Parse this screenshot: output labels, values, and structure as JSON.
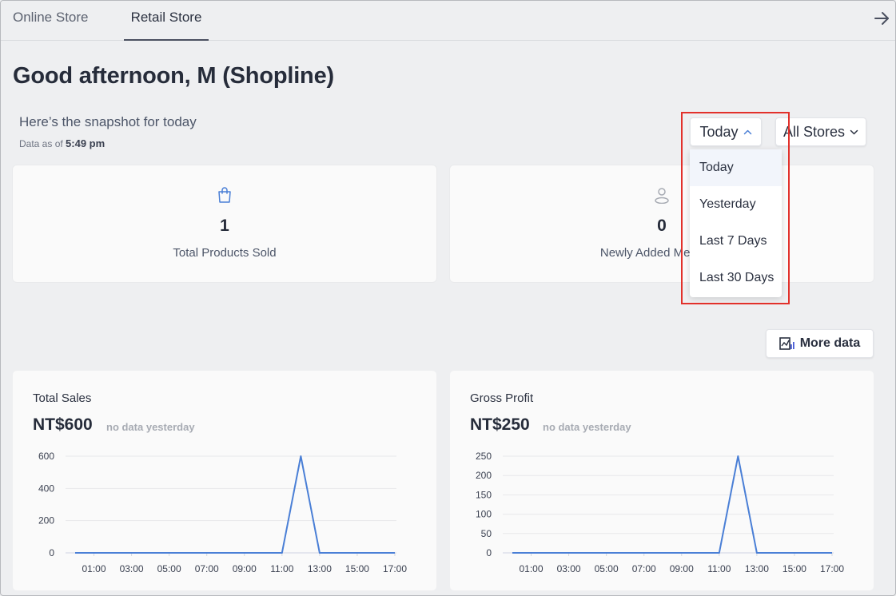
{
  "tabs": [
    {
      "label": "Online Store"
    },
    {
      "label": "Retail Store"
    }
  ],
  "greeting": "Good afternoon, M (Shopline)",
  "snapshot": {
    "title": "Here’s the snapshot for today",
    "time_prefix": "Data as of",
    "time": "5:49 pm"
  },
  "filters": {
    "period_selected": "Today",
    "store_selected": "All Stores",
    "period_options": [
      "Today",
      "Yesterday",
      "Last 7 Days",
      "Last 30 Days"
    ]
  },
  "stats": [
    {
      "value": "1",
      "label": "Total Products Sold",
      "icon": "shopping-bag-icon"
    },
    {
      "value": "0",
      "label": "Newly Added Members",
      "icon": "person-icon"
    }
  ],
  "more_data_label": "More data",
  "colors": {
    "accent": "#4a7fd6",
    "highlight": "#e2312b"
  },
  "charts": [
    {
      "title": "Total Sales",
      "amount": "NT$600",
      "note": "no data yesterday"
    },
    {
      "title": "Gross Profit",
      "amount": "NT$250",
      "note": "no data yesterday"
    }
  ],
  "chart_data": [
    {
      "type": "line",
      "x": [
        "00:00",
        "01:00",
        "02:00",
        "03:00",
        "04:00",
        "05:00",
        "06:00",
        "07:00",
        "08:00",
        "09:00",
        "10:00",
        "11:00",
        "12:00",
        "13:00",
        "14:00",
        "15:00",
        "16:00",
        "17:00"
      ],
      "xtick_labels": [
        "01:00",
        "03:00",
        "05:00",
        "07:00",
        "09:00",
        "11:00",
        "13:00",
        "15:00",
        "17:00"
      ],
      "yticks": [
        "0",
        "200",
        "400",
        "600"
      ],
      "ylim": [
        0,
        600
      ],
      "series": [
        {
          "values": [
            0,
            0,
            0,
            0,
            0,
            0,
            0,
            0,
            0,
            0,
            0,
            0,
            600,
            0,
            0,
            0,
            0,
            0
          ]
        }
      ],
      "grid": true
    },
    {
      "type": "line",
      "x": [
        "00:00",
        "01:00",
        "02:00",
        "03:00",
        "04:00",
        "05:00",
        "06:00",
        "07:00",
        "08:00",
        "09:00",
        "10:00",
        "11:00",
        "12:00",
        "13:00",
        "14:00",
        "15:00",
        "16:00",
        "17:00"
      ],
      "xtick_labels": [
        "01:00",
        "03:00",
        "05:00",
        "07:00",
        "09:00",
        "11:00",
        "13:00",
        "15:00",
        "17:00"
      ],
      "yticks": [
        "0",
        "50",
        "100",
        "150",
        "200",
        "250"
      ],
      "ylim": [
        0,
        250
      ],
      "series": [
        {
          "values": [
            0,
            0,
            0,
            0,
            0,
            0,
            0,
            0,
            0,
            0,
            0,
            0,
            250,
            0,
            0,
            0,
            0,
            0
          ]
        }
      ],
      "grid": true
    }
  ]
}
